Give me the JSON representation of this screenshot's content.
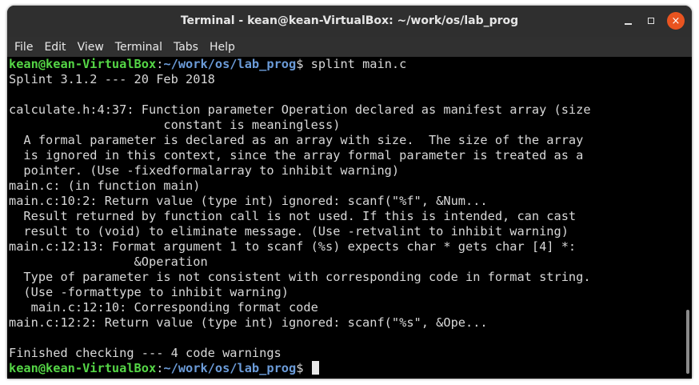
{
  "window": {
    "title": "Terminal - kean@kean-VirtualBox: ~/work/os/lab_prog",
    "buttons": {
      "minimize": "–",
      "maximize": "□",
      "close": "×"
    }
  },
  "menubar": {
    "items": [
      "File",
      "Edit",
      "View",
      "Terminal",
      "Tabs",
      "Help"
    ]
  },
  "prompt": {
    "user_host": "kean@kean-VirtualBox",
    "colon": ":",
    "path": "~/work/os/lab_prog",
    "dollar": "$",
    "command": " splint main.c"
  },
  "output": [
    "Splint 3.1.2 --- 20 Feb 2018",
    "",
    "calculate.h:4:37: Function parameter Operation declared as manifest array (size",
    "                     constant is meaningless)",
    "  A formal parameter is declared as an array with size.  The size of the array",
    "  is ignored in this context, since the array formal parameter is treated as a",
    "  pointer. (Use -fixedformalarray to inhibit warning)",
    "main.c: (in function main)",
    "main.c:10:2: Return value (type int) ignored: scanf(\"%f\", &Num...",
    "  Result returned by function call is not used. If this is intended, can cast",
    "  result to (void) to eliminate message. (Use -retvalint to inhibit warning)",
    "main.c:12:13: Format argument 1 to scanf (%s) expects char * gets char [4] *:",
    "                 &Operation",
    "  Type of parameter is not consistent with corresponding code in format string.",
    "  (Use -formattype to inhibit warning)",
    "   main.c:12:10: Corresponding format code",
    "main.c:12:2: Return value (type int) ignored: scanf(\"%s\", &Ope...",
    "",
    "Finished checking --- 4 code warnings"
  ],
  "colors": {
    "prompt_user": "#55d646",
    "prompt_path": "#6b9bd8",
    "close_button": "#e95420",
    "terminal_bg": "#000000",
    "titlebar_bg": "#2f2f2f"
  }
}
